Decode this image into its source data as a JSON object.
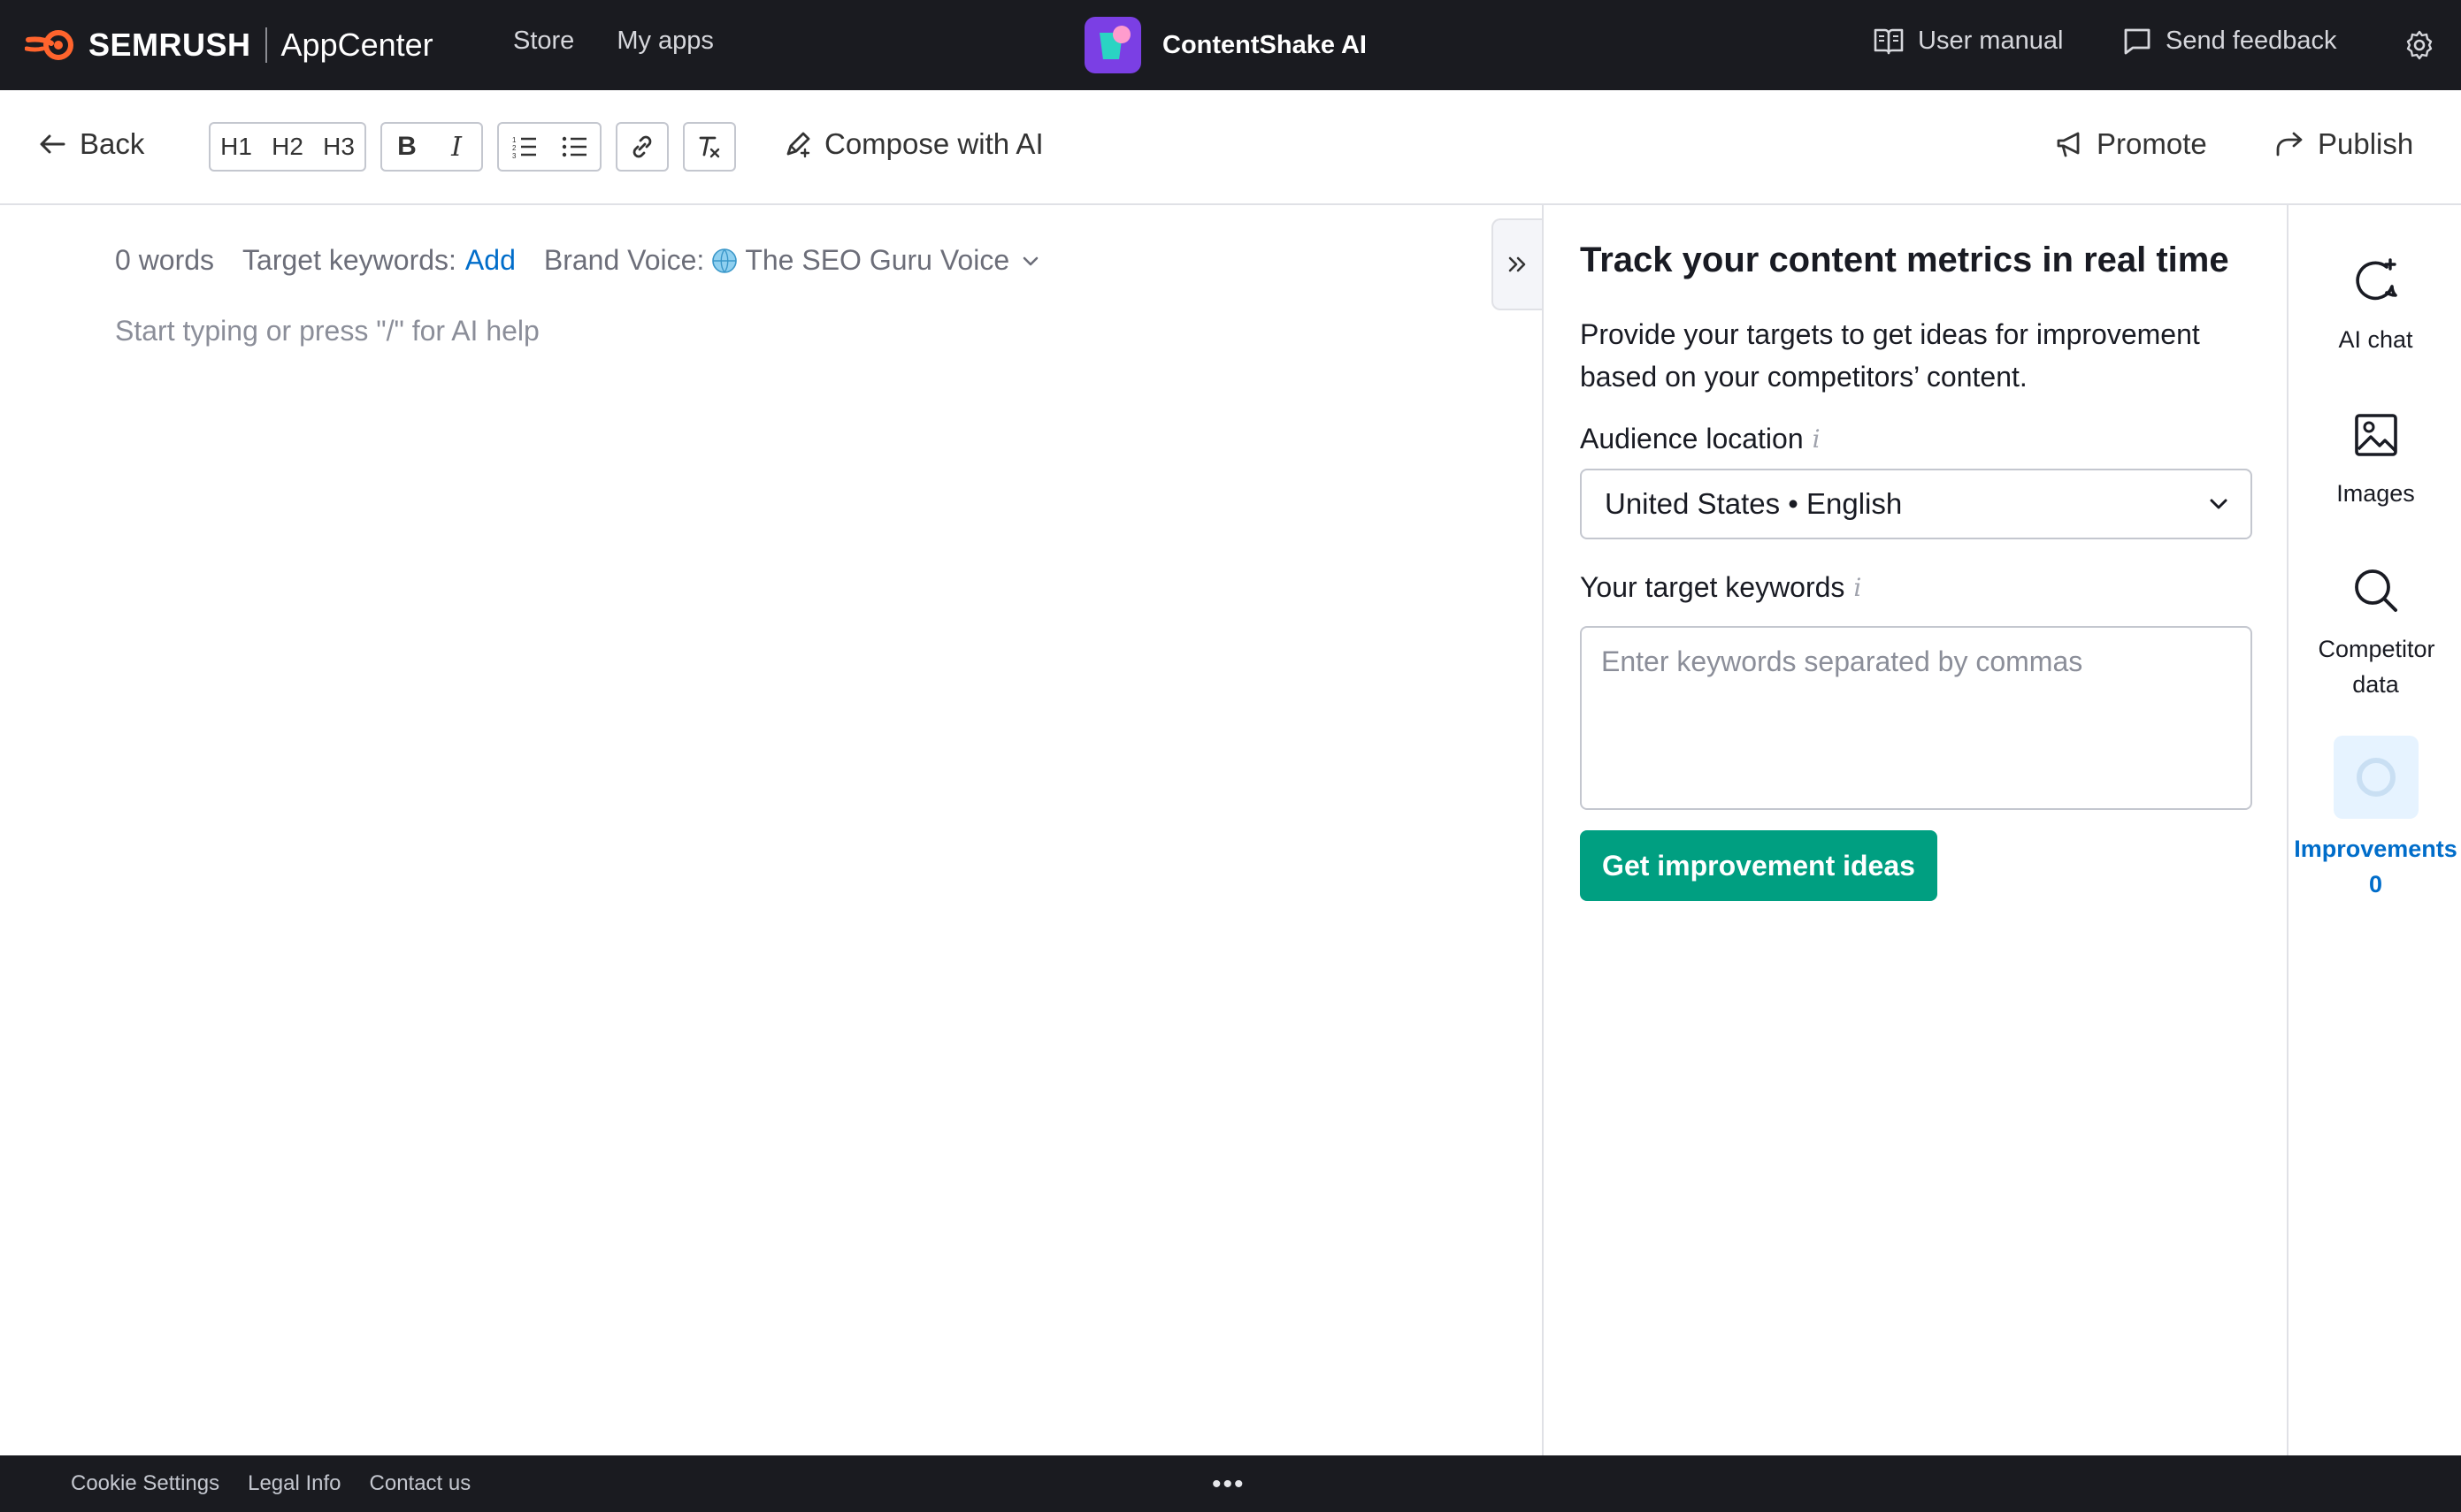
{
  "topbar": {
    "brand_name": "SEMRUSH",
    "brand_app": "AppCenter",
    "nav": [
      {
        "label": "Store"
      },
      {
        "label": "My apps"
      }
    ],
    "app_title": "ContentShake AI",
    "user_manual": "User manual",
    "send_feedback": "Send feedback",
    "icons": {
      "manual": "book-icon",
      "feedback": "chat-icon",
      "settings": "gear-icon"
    }
  },
  "toolbar": {
    "back_label": "Back",
    "headings": [
      "H1",
      "H2",
      "H3"
    ],
    "format": {
      "bold": "B",
      "italic": "I"
    },
    "compose_label": "Compose with AI",
    "promote_label": "Promote",
    "publish_label": "Publish"
  },
  "editor": {
    "word_count": "0 words",
    "target_keywords_label": "Target keywords:",
    "target_keywords_action": "Add",
    "brand_voice_label": "Brand Voice:",
    "brand_voice_value": "The SEO Guru Voice",
    "placeholder": "Start typing or press \"/\" for AI help"
  },
  "panel": {
    "title": "Track your content metrics in real time",
    "description": "Provide your targets to get ideas for improvement based on your competitors’ content.",
    "audience_label": "Audience location",
    "audience_value": "United States • English",
    "keywords_label": "Your target keywords",
    "keywords_placeholder": "Enter keywords separated by commas",
    "keywords_value": "",
    "cta_label": "Get improvement ideas",
    "info_glyph": "i"
  },
  "rail": {
    "items": [
      {
        "label": "AI chat",
        "icon": "chat-sparkle-icon"
      },
      {
        "label": "Images",
        "icon": "image-icon"
      },
      {
        "label": "Competitor data",
        "icon": "search-icon"
      },
      {
        "label": "Improvements",
        "count": "0",
        "icon": "ring-icon",
        "active": true
      }
    ]
  },
  "footer": {
    "links": [
      "Cookie Settings",
      "Legal Info",
      "Contact us"
    ],
    "more": "•••"
  },
  "colors": {
    "topbar_bg": "#1a1b20",
    "brand_orange": "#ff642d",
    "link_blue": "#006dca",
    "cta_green": "#009f81",
    "app_purple": "#7b3fe4"
  }
}
